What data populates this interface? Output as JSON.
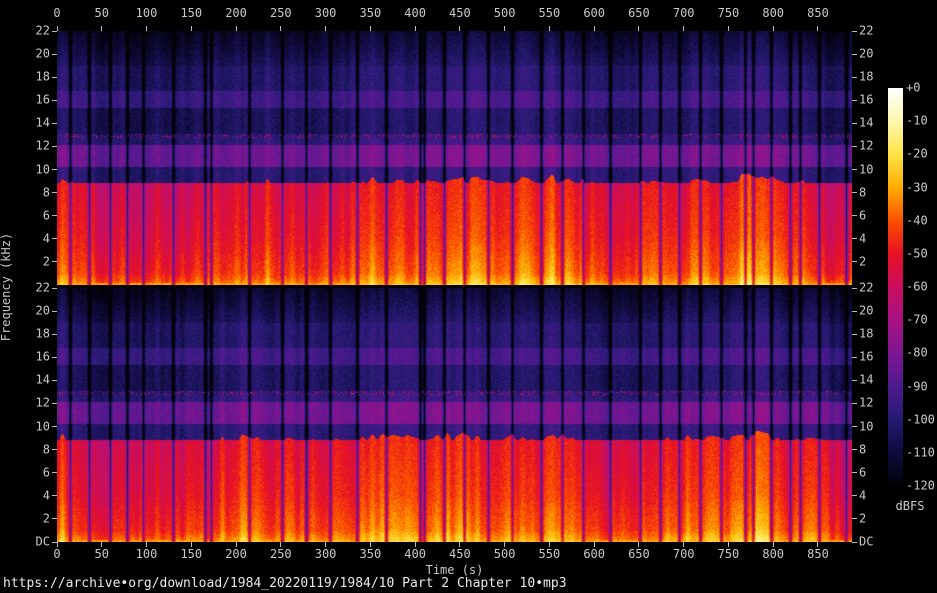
{
  "source_text": "https://archive•org/download/1984_20220119/1984/10 Part 2 Chapter 10•mp3",
  "axes": {
    "time_label": "Time (s)",
    "freq_label": "Frequency (kHz)",
    "time_tick_labels": [
      "0",
      "50",
      "100",
      "150",
      "200",
      "250",
      "300",
      "350",
      "400",
      "450",
      "500",
      "550",
      "600",
      "650",
      "700",
      "750",
      "800",
      "850"
    ],
    "freq_tick_labels": [
      "22",
      "20",
      "18",
      "16",
      "14",
      "12",
      "10",
      "8",
      "6",
      "4",
      "2"
    ],
    "dc_tick_label": "DC"
  },
  "colorbar": {
    "unit_label": "dBFS",
    "tick_labels": [
      "+0",
      "-10",
      "-20",
      "-30",
      "-40",
      "-50",
      "-60",
      "-70",
      "-80",
      "-90",
      "-100",
      "-110",
      "-120"
    ],
    "gradient_stops": [
      {
        "db": 0,
        "color": "#ffffff"
      },
      {
        "db": -10,
        "color": "#fff8b0"
      },
      {
        "db": -20,
        "color": "#ffe246"
      },
      {
        "db": -30,
        "color": "#ffac00"
      },
      {
        "db": -40,
        "color": "#fb5000"
      },
      {
        "db": -50,
        "color": "#e71023"
      },
      {
        "db": -60,
        "color": "#ca0e5e"
      },
      {
        "db": -70,
        "color": "#a81284"
      },
      {
        "db": -80,
        "color": "#7c1692"
      },
      {
        "db": -90,
        "color": "#4c1a8e"
      },
      {
        "db": -100,
        "color": "#251a72"
      },
      {
        "db": -110,
        "color": "#0e0b3c"
      },
      {
        "db": -120,
        "color": "#020208"
      }
    ]
  },
  "chart_data": {
    "type": "heatmap",
    "subtype": "stereo-audio-spectrogram",
    "panels": 2,
    "x_axis": {
      "label": "Time (s)",
      "min": 0,
      "max": 888,
      "tick_step": 50
    },
    "y_axis": {
      "label": "Frequency (kHz)",
      "min": 0,
      "max": 22,
      "tick_step": 2,
      "bottom_tick": "DC"
    },
    "color_axis": {
      "label": "dBFS",
      "min": -120,
      "max": 0,
      "tick_step": 10
    },
    "frequency_profile": [
      {
        "f0": 0,
        "f1": 1,
        "l0": -28,
        "l1": -38
      },
      {
        "f0": 1,
        "f1": 4,
        "l0": -38,
        "l1": -45
      },
      {
        "f0": 4,
        "f1": 8.85,
        "l0": -45,
        "l1": -50
      },
      {
        "f0": 8.85,
        "f1": 10.2,
        "l0": -96,
        "l1": -96
      },
      {
        "f0": 10.2,
        "f1": 12.1,
        "l0": -80,
        "l1": -80
      },
      {
        "f0": 12.1,
        "f1": 12.75,
        "l0": -95,
        "l1": -95
      },
      {
        "f0": 12.75,
        "f1": 13.05,
        "l0": -97,
        "l1": -97,
        "speckle": true
      },
      {
        "f0": 13.05,
        "f1": 15.3,
        "l0": -101,
        "l1": -101
      },
      {
        "f0": 15.3,
        "f1": 16.8,
        "l0": -91,
        "l1": -91
      },
      {
        "f0": 16.8,
        "f1": 19,
        "l0": -99,
        "l1": -99
      },
      {
        "f0": 19,
        "f1": 22,
        "l0": -102,
        "l1": -112
      }
    ],
    "silence_gaps_s": [
      14,
      36,
      59,
      78,
      96,
      130,
      165,
      172,
      215,
      251,
      278,
      305,
      335,
      368,
      406,
      410,
      432,
      455,
      481,
      508,
      541,
      564,
      588,
      618,
      651,
      674,
      695,
      718,
      742,
      769,
      777,
      798,
      819,
      830,
      851,
      881
    ],
    "notes": [
      "broadband speech energy from DC to ~9 kHz at -28..-50 dBFS (red/orange/yellow)",
      "sharp lowpass cutoff near 9 kHz",
      "artifact band ~10.2-12.1 kHz at ~-80 dBFS (purple)",
      "intermittent speckle line near 12.9 kHz",
      "faint band ~15.3-16.8 kHz at ~-91 dBFS",
      "noise floor -95..-112 dBFS with vertical pause striping",
      "top and bottom channel panels nearly identical"
    ]
  }
}
